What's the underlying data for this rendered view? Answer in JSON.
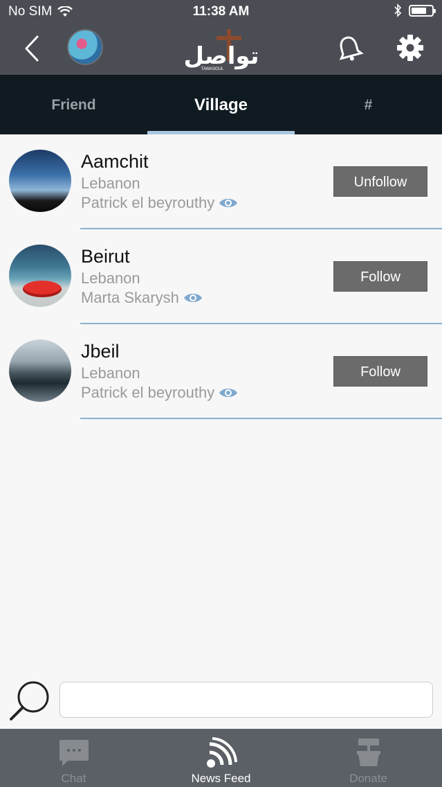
{
  "status_bar": {
    "carrier": "No SIM",
    "time": "11:38 AM",
    "battery_level": 0.75
  },
  "header": {
    "logo_text": "تواصل",
    "logo_subtext": "TAWASOUL",
    "icons": [
      "back-icon",
      "profile-avatar",
      "bell-icon",
      "gear-icon"
    ]
  },
  "tabs": [
    {
      "label": "Friend",
      "active": false
    },
    {
      "label": "Village",
      "active": true
    },
    {
      "label": "#",
      "active": false
    }
  ],
  "villages": [
    {
      "name": "Aamchit",
      "country": "Lebanon",
      "owner": "Patrick el beyrouthy",
      "button": "Unfollow"
    },
    {
      "name": "Beirut",
      "country": "Lebanon",
      "owner": "Marta Skarysh",
      "button": "Follow"
    },
    {
      "name": "Jbeil",
      "country": "Lebanon",
      "owner": "Patrick el beyrouthy",
      "button": "Follow"
    }
  ],
  "search": {
    "value": "",
    "placeholder": ""
  },
  "bottom_nav": [
    {
      "label": "Chat",
      "icon": "chat-icon",
      "active": false
    },
    {
      "label": "News Feed",
      "icon": "feed-icon",
      "active": true
    },
    {
      "label": "Donate",
      "icon": "donate-icon",
      "active": false
    }
  ],
  "colors": {
    "header_bg": "#4a4e54",
    "tabs_bg": "#0f1a21",
    "tab_indicator": "#a8c6de",
    "button_bg": "#6b6b6b",
    "divider": "#8bb0cc",
    "bottom_bar_bg": "#5b6066"
  }
}
